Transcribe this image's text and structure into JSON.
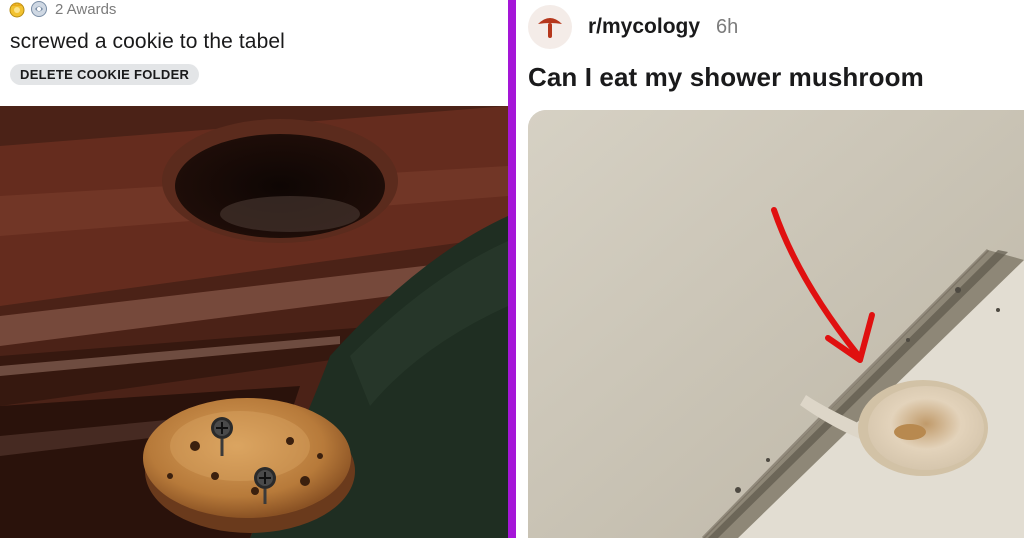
{
  "left_post": {
    "awards_label": "2 Awards",
    "title": "screwed a cookie to the tabel",
    "flair": "DELETE COOKIE FOLDER",
    "award_icons": [
      "gold-award-icon",
      "helpful-award-icon"
    ],
    "image_icon": "cookie-screwed-to-table-photo"
  },
  "right_post": {
    "subreddit": "r/mycology",
    "age": "6h",
    "title": "Can I eat my shower mushroom",
    "avatar_icon": "mushroom-icon",
    "image_icon": "shower-mushroom-photo"
  },
  "colors": {
    "divider": "#a516d8",
    "flair_bg": "#e3e5e7",
    "avatar_mushroom": "#b5371c",
    "arrow": "#e01010"
  }
}
